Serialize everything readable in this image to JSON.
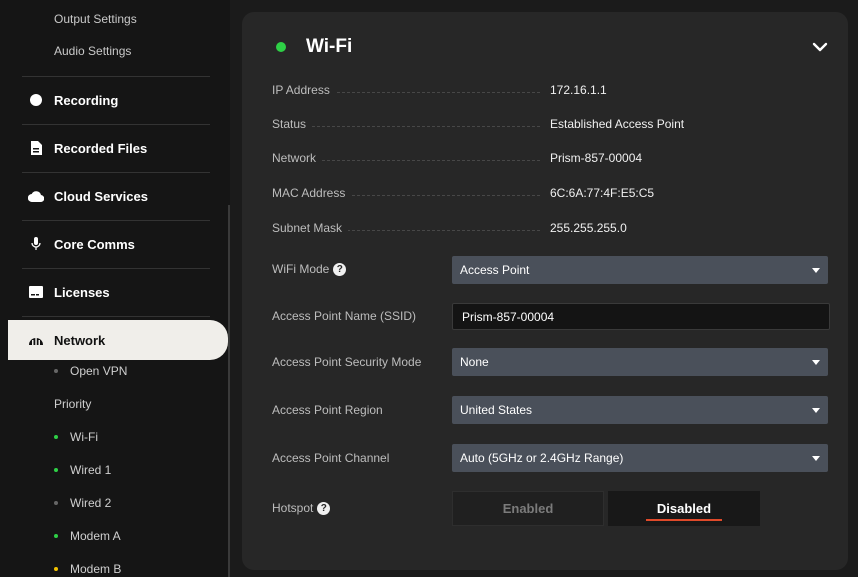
{
  "sidebar": {
    "top_items": [
      "Output Settings",
      "Audio Settings"
    ],
    "nav": {
      "recording": "Recording",
      "recorded_files": "Recorded Files",
      "cloud_services": "Cloud Services",
      "core_comms": "Core Comms",
      "licenses": "Licenses",
      "network": "Network"
    },
    "network_children": {
      "open_vpn": "Open VPN",
      "priority": "Priority",
      "wifi": "Wi-Fi",
      "wired1": "Wired 1",
      "wired2": "Wired 2",
      "modem_a": "Modem A",
      "modem_b": "Modem B"
    },
    "status_colors": {
      "open_vpn": "#666666",
      "wifi": "#2ed046",
      "wired1": "#2ed046",
      "wired2": "#666666",
      "modem_a": "#2ed046",
      "modem_b": "#f2c200"
    }
  },
  "panel": {
    "title": "Wi-Fi",
    "status_color": "#2ed046",
    "info": [
      {
        "label": "IP Address",
        "value": "172.16.1.1"
      },
      {
        "label": "Status",
        "value": "Established Access Point"
      },
      {
        "label": "Network",
        "value": "Prism-857-00004"
      },
      {
        "label": "MAC Address",
        "value": "6C:6A:77:4F:E5:C5"
      },
      {
        "label": "Subnet Mask",
        "value": "255.255.255.0"
      }
    ],
    "wifi_mode": {
      "label": "WiFi Mode",
      "value": "Access Point"
    },
    "ssid": {
      "label": "Access Point Name (SSID)",
      "value": "Prism-857-00004"
    },
    "security": {
      "label": "Access Point Security Mode",
      "value": "None"
    },
    "region": {
      "label": "Access Point Region",
      "value": "United States"
    },
    "channel": {
      "label": "Access Point Channel",
      "value": "Auto (5GHz or 2.4GHz Range)"
    },
    "hotspot": {
      "label": "Hotspot",
      "enabled": "Enabled",
      "disabled": "Disabled",
      "selected": "Disabled"
    }
  }
}
